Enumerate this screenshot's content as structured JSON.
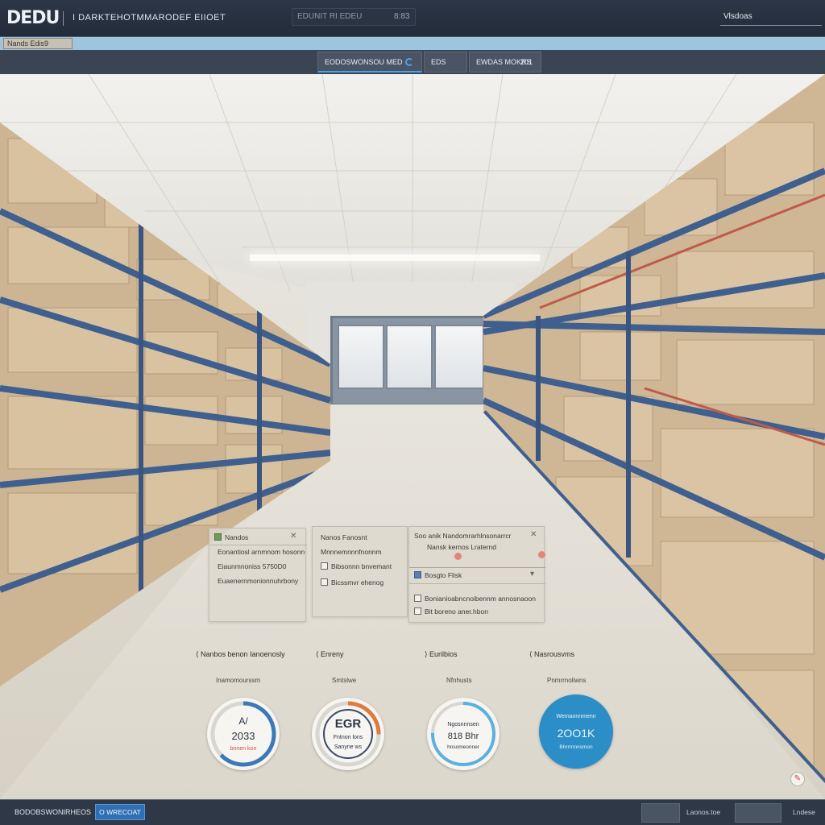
{
  "header": {
    "logo": "DEDU",
    "title": "I DARKTEHOTMMARODEF EIIOET",
    "search_placeholder": "EDUNIT RI EDEU",
    "search_count": "8:83",
    "user": "Vlsdoas"
  },
  "subbar": {
    "tab_label": "Nands Edis9"
  },
  "nav": {
    "tabs": [
      {
        "label": "EODOSWONSOU MED"
      },
      {
        "label": "EDS"
      },
      {
        "label": "EWDAS MOKRS"
      }
    ],
    "tab3_count": "201"
  },
  "panels": {
    "left": {
      "title": "Nandos",
      "rows": [
        "Eonantiosl arnmnom hosonn",
        "Eiaunmnoniss 5750D0",
        "Euaenernmonionnuhrbony"
      ]
    },
    "middle": {
      "title": "Nanos Fanosnt",
      "rows": [
        "Mnnnemnnnfnonnm",
        "Bibsonnn bnvemant",
        "Bicssmvr ehenog"
      ]
    },
    "right": {
      "title": "Soo anik Nandomrarhlnsonarrcr",
      "subtitle": "Nansk kernos Lraternd",
      "section": "Bosgto Flisk",
      "rows": [
        "Bonianioabncnoibennm annosnaoon",
        "Bit boreno aner.hbon"
      ]
    }
  },
  "kpis": [
    {
      "title": "Nanbos benon Ianoenosly",
      "subtitle": "Inamomourssm",
      "value_line1": "A/",
      "value_line2": "2033",
      "caption": "bnnen kon"
    },
    {
      "title": "Enreny",
      "subtitle": "Smtslwe",
      "value_line1": "EGR",
      "value_line2": "Fntnon lons",
      "caption": "Sanyne ws"
    },
    {
      "title": "Eurilbios",
      "subtitle": "Nfnhusts",
      "value_line1": "Ngosnnnsen",
      "value_line2": "818 Bhr",
      "caption": "hnsomeonner"
    },
    {
      "title": "Nasrousvms",
      "subtitle": "Pnmrrnoliwns",
      "value_line1": "Wemaonnmenn",
      "value_line2": "2OO1K",
      "caption": "Bhrrrnnnsmon"
    }
  ],
  "bottombar": {
    "left_label": "BODOBSWONIRHEOS",
    "button_label": "O WRECOAT",
    "right_label": "Laonos.toe",
    "far_right_label": "Lndese"
  },
  "colors": {
    "accent": "#4aa3ea",
    "gauge_solid": "#2b8ec7",
    "shelf_blue": "#3f5f8f",
    "shelf_red": "#c05a4a"
  }
}
